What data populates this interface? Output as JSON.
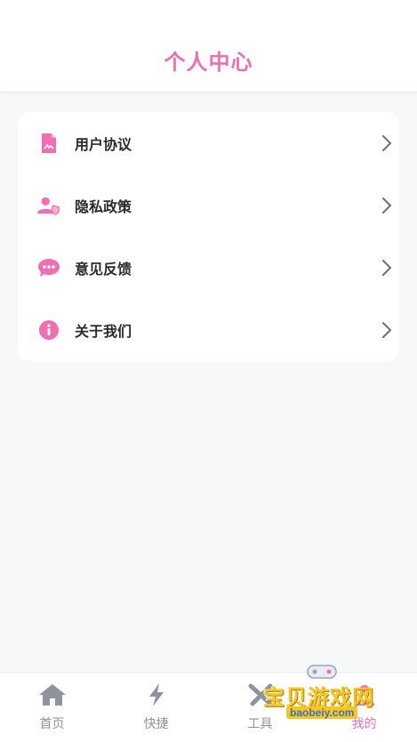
{
  "header": {
    "title": "个人中心"
  },
  "menu": {
    "items": [
      {
        "label": "用户协议",
        "icon": "document-icon"
      },
      {
        "label": "隐私政策",
        "icon": "user-shield-icon"
      },
      {
        "label": "意见反馈",
        "icon": "chat-bubble-icon"
      },
      {
        "label": "关于我们",
        "icon": "info-icon"
      }
    ]
  },
  "tabbar": {
    "tabs": [
      {
        "label": "首页",
        "icon": "home-icon",
        "active": false
      },
      {
        "label": "快捷",
        "icon": "lightning-icon",
        "active": false
      },
      {
        "label": "工具",
        "icon": "tools-icon",
        "active": false
      },
      {
        "label": "我的",
        "icon": "profile-icon",
        "active": true
      }
    ]
  },
  "watermark": {
    "title": "宝贝游戏网",
    "url": "baobeiy.com"
  },
  "colors": {
    "accent": "#ef6fb2",
    "text": "#2b2b2b",
    "muted": "#8f939c",
    "background": "#f7f8fa"
  }
}
